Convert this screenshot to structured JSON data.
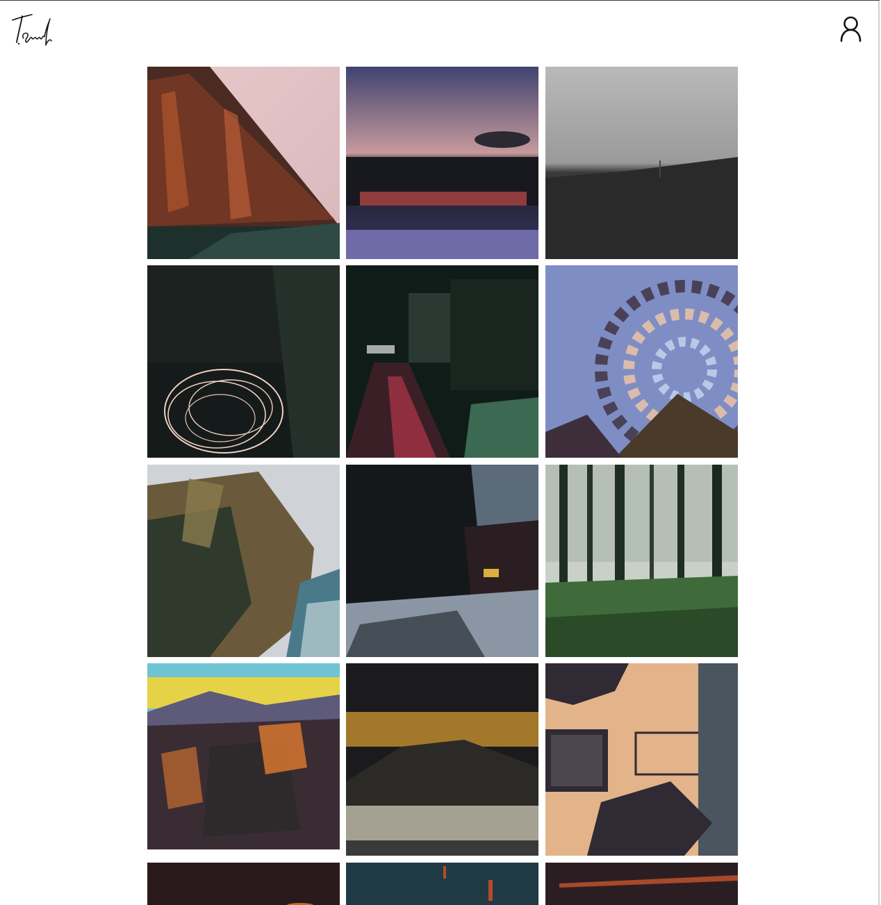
{
  "header": {
    "logo_text": "T.Svenb",
    "account_label": "Account",
    "account_icon": "user-icon"
  },
  "gallery": {
    "items": [
      {
        "name": "artwork-warehouse-canal",
        "colors": [
          "#e8c9c9",
          "#5b2e22",
          "#1d302b"
        ]
      },
      {
        "name": "artwork-dusk-river",
        "colors": [
          "#5b5a86",
          "#1a1d24",
          "#c44a4a"
        ]
      },
      {
        "name": "artwork-grey-field",
        "colors": [
          "#b9b9b9",
          "#2a2a2a",
          "#8f8f8f"
        ]
      },
      {
        "name": "artwork-light-swirl",
        "colors": [
          "#151b1a",
          "#2c3a2a",
          "#f1d1c0"
        ]
      },
      {
        "name": "artwork-night-street",
        "colors": [
          "#101c18",
          "#b3354a",
          "#4f8a6a"
        ]
      },
      {
        "name": "artwork-vortex-sky",
        "colors": [
          "#7e8dc4",
          "#3e2e3c",
          "#f3c7a6"
        ]
      },
      {
        "name": "artwork-coastal-cliff",
        "colors": [
          "#cfd3d7",
          "#6a5a3b",
          "#2f3a2c"
        ]
      },
      {
        "name": "artwork-winter-cabin",
        "colors": [
          "#5c6b7a",
          "#15181b",
          "#dcae3f"
        ]
      },
      {
        "name": "artwork-forest",
        "colors": [
          "#c9d0c8",
          "#1f2e22",
          "#3f6b3a"
        ]
      },
      {
        "name": "artwork-steps-sunset",
        "colors": [
          "#e5d247",
          "#3a2c33",
          "#e07a2f"
        ]
      },
      {
        "name": "artwork-hill-town",
        "colors": [
          "#1b1b1d",
          "#c5902f",
          "#d9d4c0"
        ]
      },
      {
        "name": "artwork-balcony-wall",
        "colors": [
          "#e3b38a",
          "#2f2a33",
          "#f4f4f4"
        ]
      },
      {
        "name": "artwork-dark-glow",
        "colors": [
          "#2a1a1c",
          "#1e1416",
          "#c76a2a"
        ]
      },
      {
        "name": "artwork-blue-night",
        "colors": [
          "#1f3a45",
          "#2c4a56",
          "#b84a2a"
        ]
      },
      {
        "name": "artwork-red-horizon",
        "colors": [
          "#2b1e22",
          "#a8492a",
          "#3a2a2f"
        ]
      }
    ]
  }
}
